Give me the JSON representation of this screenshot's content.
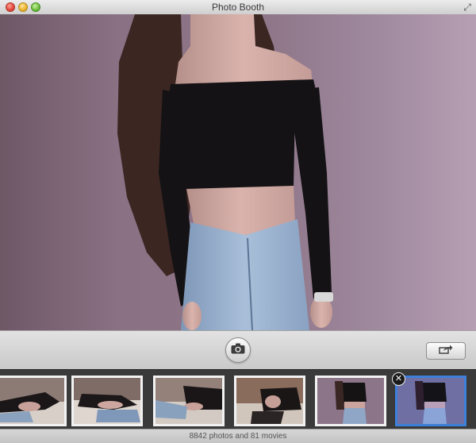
{
  "window": {
    "title": "Photo Booth"
  },
  "status": {
    "text": "8842 photos and 81 movies"
  },
  "icons": {
    "close": "close-dot",
    "minimize": "minimize-dot",
    "zoom": "zoom-dot",
    "fullscreen": "fullscreen-arrows-icon",
    "shutter": "camera-icon",
    "share": "share-arrow-icon",
    "delete": "x-icon"
  },
  "filmstrip": {
    "thumbnails": [
      {
        "id": "thumb-1",
        "scene": "lying"
      },
      {
        "id": "thumb-2",
        "scene": "lying"
      },
      {
        "id": "thumb-3",
        "scene": "lying"
      },
      {
        "id": "thumb-4",
        "scene": "lying"
      },
      {
        "id": "thumb-5",
        "scene": "standing"
      },
      {
        "id": "thumb-6",
        "scene": "standing",
        "selected": true
      }
    ]
  },
  "colors": {
    "selection": "#3d7fd9",
    "wall": "#8e7587"
  }
}
